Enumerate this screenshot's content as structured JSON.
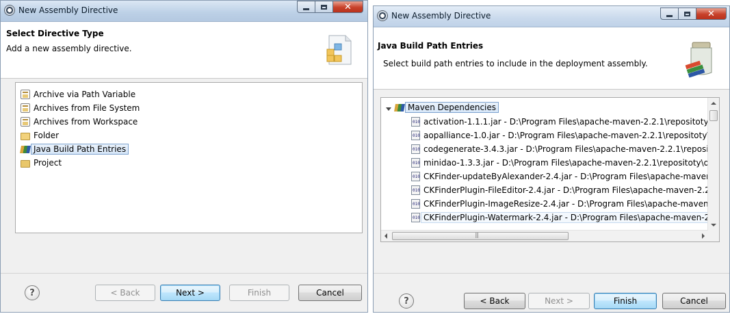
{
  "left_dialog": {
    "title": "New Assembly Directive",
    "header_title": "Select Directive Type",
    "header_desc": "Add a new assembly directive.",
    "items": [
      {
        "label": "Archive via Path Variable",
        "icon": "archive-icon"
      },
      {
        "label": "Archives from File System",
        "icon": "archive-icon"
      },
      {
        "label": "Archives from Workspace",
        "icon": "archive-icon"
      },
      {
        "label": "Folder",
        "icon": "folder-icon"
      },
      {
        "label": "Java Build Path Entries",
        "icon": "library-icon",
        "selected": true
      },
      {
        "label": "Project",
        "icon": "project-folder-icon"
      }
    ],
    "buttons": {
      "help": "?",
      "back": "< Back",
      "next": "Next >",
      "finish": "Finish",
      "cancel": "Cancel"
    }
  },
  "right_dialog": {
    "title": "New Assembly Directive",
    "header_title": "Java Build Path Entries",
    "header_desc": "Select build path entries to include in the deployment assembly.",
    "tree_root": "Maven Dependencies",
    "entries": [
      "activation-1.1.1.jar - D:\\Program Files\\apache-maven-2.2.1\\repositoty\\",
      "aopalliance-1.0.jar - D:\\Program Files\\apache-maven-2.2.1\\repositoty\\",
      "codegenerate-3.4.3.jar - D:\\Program Files\\apache-maven-2.2.1\\reposi",
      "minidao-1.3.3.jar - D:\\Program Files\\apache-maven-2.2.1\\repositoty\\o",
      "CKFinder-updateByAlexander-2.4.jar - D:\\Program Files\\apache-maver",
      "CKFinderPlugin-FileEditor-2.4.jar - D:\\Program Files\\apache-maven-2.2",
      "CKFinderPlugin-ImageResize-2.4.jar - D:\\Program Files\\apache-maven",
      "CKFinderPlugin-Watermark-2.4.jar - D:\\Program Files\\apache-maven-2"
    ],
    "scroll_thumb_marker": "III",
    "buttons": {
      "help": "?",
      "back": "< Back",
      "next": "Next >",
      "finish": "Finish",
      "cancel": "Cancel"
    }
  },
  "colors": {
    "selection_border": "#7da2ce",
    "default_button_border": "#3c7fb1",
    "close_button": "#c8412a"
  }
}
